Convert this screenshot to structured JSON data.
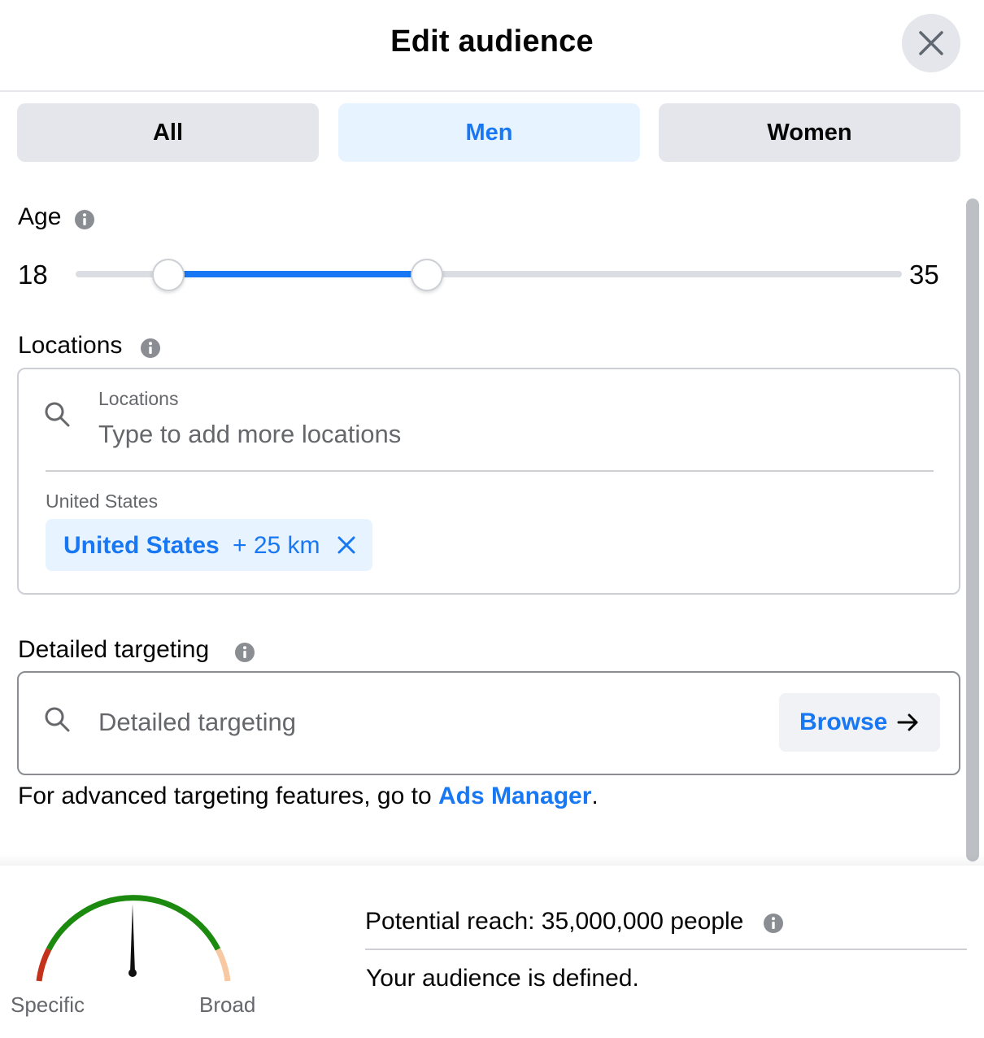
{
  "header": {
    "title": "Edit audience",
    "close_icon": "close-icon"
  },
  "gender_tabs": [
    {
      "label": "All",
      "selected": false
    },
    {
      "label": "Men",
      "selected": true
    },
    {
      "label": "Women",
      "selected": false
    }
  ],
  "age": {
    "label": "Age",
    "min_label": "18",
    "max_label": "35",
    "range_min": 18,
    "range_max": 65,
    "selected_min": 18,
    "selected_max": 35
  },
  "locations": {
    "label": "Locations",
    "field_label": "Locations",
    "placeholder": "Type to add more locations",
    "group_label": "United States",
    "chip": {
      "name": "United States",
      "radius": "+ 25 km"
    }
  },
  "detailed_targeting": {
    "label": "Detailed targeting",
    "placeholder": "Detailed targeting",
    "browse_label": "Browse"
  },
  "advanced": {
    "prefix": "For advanced targeting features, go to ",
    "link": "Ads Manager",
    "suffix": "."
  },
  "gauge": {
    "left_label": "Specific",
    "right_label": "Broad",
    "needle_position": 0.5
  },
  "reach": {
    "text": "Potential reach: 35,000,000 people",
    "status": "Your audience is defined."
  },
  "colors": {
    "accent": "#1877f2",
    "tab_selected_bg": "#e7f3ff",
    "tab_bg": "#e4e6eb",
    "gauge_green": "#1c8a0e",
    "gauge_red": "#c4321b",
    "gauge_peach": "#f7c8a1"
  }
}
